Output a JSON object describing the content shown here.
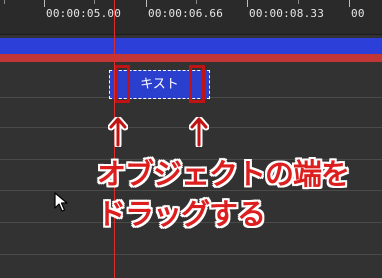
{
  "timeline": {
    "ruler_labels": [
      "00:00:05.00",
      "00:00:06.66",
      "00:00:08.33",
      "00"
    ]
  },
  "object": {
    "text": "キスト"
  },
  "annotation": {
    "lines": [
      "オブジェクトの端を",
      "ドラッグする"
    ],
    "color": "#dc1e1e"
  },
  "colors": {
    "layer_blue": "#2d3fd9",
    "layer_red": "#c23636",
    "playhead": "#e02b2b",
    "highlight": "#c01414"
  },
  "icons": [
    "arrow-up-icon",
    "mouse-pointer-icon"
  ]
}
